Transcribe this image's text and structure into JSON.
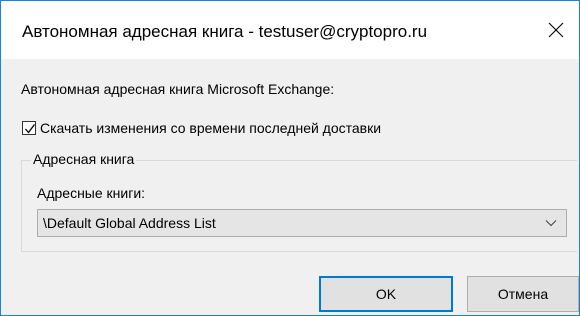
{
  "window": {
    "title": "Автономная адресная книга - testuser@cryptopro.ru"
  },
  "main_label": "Автономная адресная книга Microsoft Exchange:",
  "download_changes": {
    "checked": true,
    "label": "Скачать изменения со времени последней доставки"
  },
  "address_book_group": {
    "legend": "Адресная книга",
    "books_label": "Адресные книги:",
    "selected_book": "\\Default Global Address List"
  },
  "buttons": {
    "ok_label": "OK",
    "cancel_label": "Отмена"
  },
  "icons": {
    "close": "close-icon",
    "checkmark": "checkmark-icon",
    "dropdown": "chevron-down-icon"
  },
  "colors": {
    "window_border": "#1883d7",
    "default_button_border": "#0078d7",
    "dialog_background": "#f0f0f0"
  }
}
